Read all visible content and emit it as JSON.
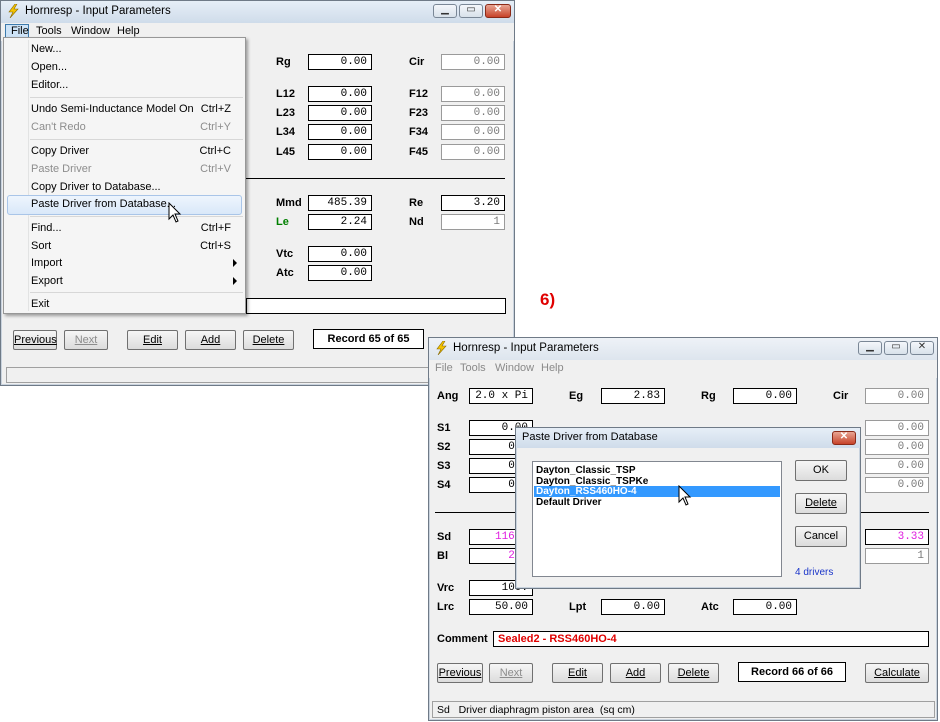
{
  "annotation": {
    "step_label": "6)",
    "color": "#e00000"
  },
  "colors": {
    "magenta_value": "#e020e0",
    "red_comment": "#e00000",
    "green_label": "#008000",
    "blue_count": "#1a35c9"
  },
  "window1": {
    "title": "Hornresp - Input Parameters",
    "menu": {
      "file": "File",
      "tools": "Tools",
      "window": "Window",
      "help": "Help"
    },
    "labels": {
      "rg": "Rg",
      "cir": "Cir",
      "l12": "L12",
      "f12": "F12",
      "l23": "L23",
      "f23": "F23",
      "l34": "L34",
      "f34": "F34",
      "l45": "L45",
      "f45": "F45",
      "mmd": "Mmd",
      "re": "Re",
      "le": "Le",
      "nd": "Nd",
      "vtc": "Vtc",
      "atc": "Atc"
    },
    "values": {
      "rg": "0.00",
      "cir": "0.00",
      "l12": "0.00",
      "f12": "0.00",
      "l23": "0.00",
      "f23": "0.00",
      "l34": "0.00",
      "f34": "0.00",
      "l45": "0.00",
      "f45": "0.00",
      "mmd": "485.39",
      "re": "3.20",
      "le": "2.24",
      "nd": "1",
      "vtc": "0.00",
      "atc": "0.00"
    },
    "buttons": {
      "previous": "Previous",
      "next": "Next",
      "edit": "Edit",
      "add": "Add",
      "delete": "Delete"
    },
    "record": "Record 65 of 65",
    "file_menu": [
      {
        "label": "New...",
        "shortcut": ""
      },
      {
        "label": "Open...",
        "shortcut": ""
      },
      {
        "label": "Editor...",
        "shortcut": ""
      },
      {
        "label": "Undo Semi-Inductance Model On",
        "shortcut": "Ctrl+Z"
      },
      {
        "label": "Can't Redo",
        "shortcut": "Ctrl+Y"
      },
      {
        "label": "Copy Driver",
        "shortcut": "Ctrl+C"
      },
      {
        "label": "Paste Driver",
        "shortcut": "Ctrl+V"
      },
      {
        "label": "Copy Driver to Database...",
        "shortcut": ""
      },
      {
        "label": "Paste Driver from Database...",
        "shortcut": ""
      },
      {
        "label": "Find...",
        "shortcut": "Ctrl+F"
      },
      {
        "label": "Sort",
        "shortcut": "Ctrl+S"
      },
      {
        "label": "Import",
        "shortcut": ""
      },
      {
        "label": "Export",
        "shortcut": ""
      },
      {
        "label": "Exit",
        "shortcut": ""
      }
    ]
  },
  "window2": {
    "title": "Hornresp - Input Parameters",
    "menu": {
      "file": "File",
      "tools": "Tools",
      "window": "Window",
      "help": "Help"
    },
    "labels": {
      "ang": "Ang",
      "eg": "Eg",
      "rg": "Rg",
      "cir": "Cir",
      "s1": "S1",
      "s2": "S2",
      "s3": "S3",
      "s4": "S4",
      "sd": "Sd",
      "bl": "Bl",
      "vrc": "Vrc",
      "lrc": "Lrc",
      "lpt": "Lpt",
      "atc": "Atc",
      "comment": "Comment"
    },
    "values": {
      "ang": "2.0 x Pi",
      "eg": "2.83",
      "rg": "0.00",
      "cir": "0.00",
      "s1": "0.00",
      "s2": "0.0",
      "s3": "0.0",
      "s4": "0.0",
      "r1c4": "0.00",
      "r2c4": "0.00",
      "r3c4": "0.00",
      "r4c4": "0.00",
      "sd": "1164.",
      "bl": "23.",
      "re": "3.33",
      "nd": "1",
      "vrc": "100.",
      "lrc": "50.00",
      "lpt": "0.00",
      "atc": "0.00",
      "comment": "Sealed2 - RSS460HO-4"
    },
    "buttons": {
      "previous": "Previous",
      "next": "Next",
      "edit": "Edit",
      "add": "Add",
      "delete": "Delete",
      "calculate": "Calculate"
    },
    "record": "Record 66 of 66",
    "status": "Sd   Driver diaphragm piston area  (sq cm)"
  },
  "dialog": {
    "title": "Paste Driver from Database",
    "drivers": [
      "Dayton_Classic_TSP",
      "Dayton_Classic_TSPKe",
      "Dayton_RSS460HO-4",
      "Default Driver"
    ],
    "ok": "OK",
    "delete": "Delete",
    "cancel": "Cancel",
    "count": "4 drivers"
  }
}
